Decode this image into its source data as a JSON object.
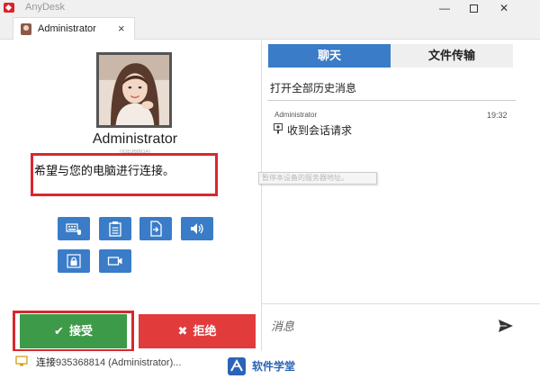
{
  "window": {
    "app_title": "AnyDesk",
    "minimize": "—",
    "close": "✕"
  },
  "tab": {
    "label": "Administrator",
    "close": "×"
  },
  "request": {
    "user_name": "Administrator",
    "user_id": "(935368814)",
    "message": "希望与您的电脑进行连接。",
    "permissions": [
      "keyboard-mouse-icon",
      "clipboard-icon",
      "file-manager-icon",
      "sound-icon",
      "lock-icon",
      "camera-icon"
    ],
    "accept_label": "接受",
    "reject_label": "拒绝",
    "accept_icon": "✔",
    "reject_icon": "✖"
  },
  "chat": {
    "tabs": {
      "chat": "聊天",
      "file_transfer": "文件传输"
    },
    "history_link": "打开全部历史消息",
    "messages": [
      {
        "sender": "Administrator",
        "time": "19:32",
        "text": "收到会话请求"
      }
    ],
    "tooltip": "暂停本设备的服务器地址。",
    "input_placeholder": "消息"
  },
  "status": {
    "prefix": "连接",
    "id": "935368814 (Administrator)..."
  },
  "watermark": {
    "text": "软件学堂"
  },
  "colors": {
    "accent_blue": "#3a7cc7",
    "accept_green": "#3d9a48",
    "reject_red": "#e23b3b",
    "highlight_red": "#d9272e"
  }
}
